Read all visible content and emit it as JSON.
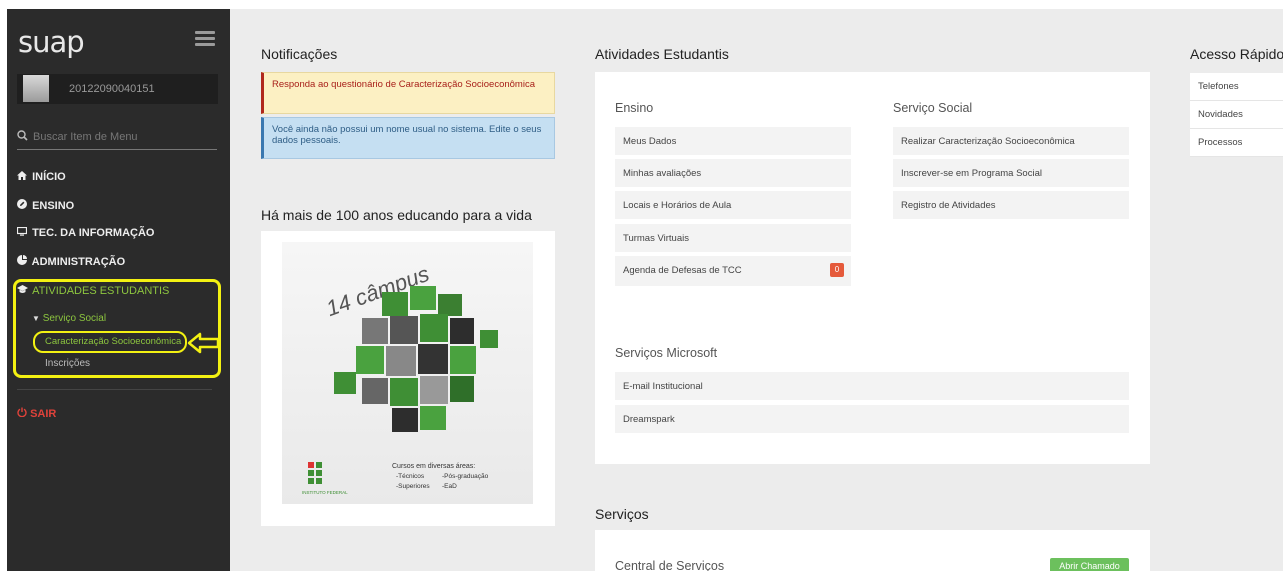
{
  "sidebar": {
    "logo": "suap",
    "user_id": "20122090040151",
    "search_placeholder": "Buscar Item de Menu",
    "menu": [
      {
        "label": "INÍCIO",
        "icon": "home-icon"
      },
      {
        "label": "ENSINO",
        "icon": "pencil-icon"
      },
      {
        "label": "TEC. DA INFORMAÇÃO",
        "icon": "monitor-icon"
      },
      {
        "label": "ADMINISTRAÇÃO",
        "icon": "pie-chart-icon"
      },
      {
        "label": "ATIVIDADES ESTUDANTIS",
        "icon": "graduation-cap-icon"
      }
    ],
    "submenu_group": "Serviço Social",
    "submenu_active": "Caracterização Socioeconômica",
    "submenu_other": "Inscrições",
    "logout": "SAIR"
  },
  "notifications": {
    "title": "Notificações",
    "alerts": [
      "Responda ao questionário de Caracterização Socioeconômica",
      "Você ainda não possui um nome usual no sistema. Edite o seus dados pessoais."
    ]
  },
  "promo": {
    "title": "Há mais de 100 anos educando para a vida",
    "campus_text": "14 câmpus",
    "courses_heading": "Cursos em diversas áreas:",
    "courses_col1": [
      "-Técnicos",
      "-Superiores"
    ],
    "courses_col2": [
      "-Pós-graduação",
      "-EaD"
    ],
    "institute_text": "INSTITUTO FEDERAL"
  },
  "atividades": {
    "title": "Atividades Estudantis",
    "ensino": {
      "title": "Ensino",
      "links": [
        "Meus Dados",
        "Minhas avaliações",
        "Locais e Horários de Aula",
        "Turmas Virtuais",
        "Agenda de Defesas de TCC"
      ],
      "badge": "0"
    },
    "servico_social": {
      "title": "Serviço Social",
      "links": [
        "Realizar Caracterização Socioeconômica",
        "Inscrever-se em Programa Social",
        "Registro de Atividades"
      ]
    },
    "microsoft": {
      "title": "Serviços Microsoft",
      "links": [
        "E-mail Institucional",
        "Dreamspark"
      ]
    }
  },
  "servicos": {
    "title": "Serviços",
    "central_title": "Central de Serviços",
    "button_label": "Abrir Chamado"
  },
  "acesso_rapido": {
    "title": "Acesso Rápido",
    "items": [
      "Telefones",
      "Novidades",
      "Processos"
    ]
  },
  "colors": {
    "sidebar_bg": "#2b2b2b",
    "accent_green": "#8dc63f",
    "highlight_yellow": "#f3f112",
    "danger_red": "#e0423a"
  }
}
